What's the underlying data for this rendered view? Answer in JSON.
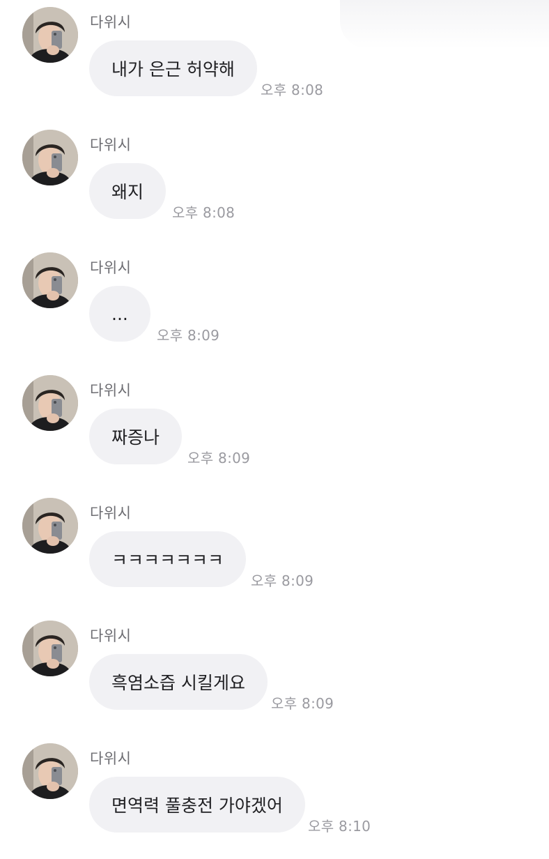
{
  "messages": [
    {
      "sender": "다위시",
      "text": "내가 은근 허약해",
      "time": "오후 8:08"
    },
    {
      "sender": "다위시",
      "text": "왜지",
      "time": "오후 8:08"
    },
    {
      "sender": "다위시",
      "text": "...",
      "time": "오후 8:09"
    },
    {
      "sender": "다위시",
      "text": "짜증나",
      "time": "오후 8:09"
    },
    {
      "sender": "다위시",
      "text": "ㅋㅋㅋㅋㅋㅋㅋ",
      "time": "오후 8:09"
    },
    {
      "sender": "다위시",
      "text": "흑염소즙 시킬게요",
      "time": "오후 8:09"
    },
    {
      "sender": "다위시",
      "text": "면역력 풀충전 가야겠어",
      "time": "오후 8:10"
    }
  ],
  "colors": {
    "bubble": "#f1f1f4",
    "sender": "#6d6d72",
    "time": "#9a9aa0",
    "text": "#1f1f22"
  },
  "icons": {
    "avatar": "profile-photo-avatar"
  }
}
